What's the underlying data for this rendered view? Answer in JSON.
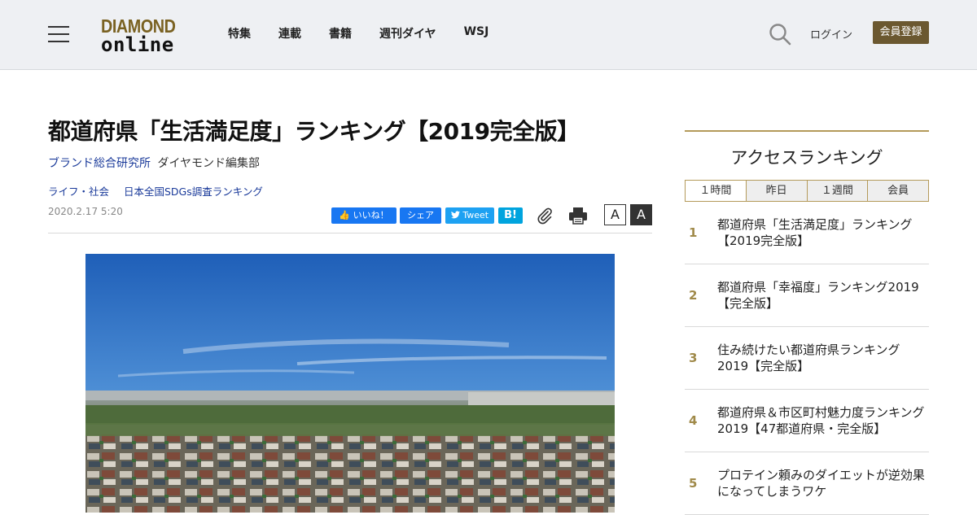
{
  "header": {
    "logo_line1": "DIAMOND",
    "logo_line2": "online",
    "nav": [
      "特集",
      "連載",
      "書籍",
      "週刊ダイヤ",
      "WSJ"
    ],
    "login": "ログイン",
    "register": "会員登録"
  },
  "article": {
    "title": "都道府県「生活満足度」ランキング【2019完全版】",
    "organization": "ブランド総合研究所",
    "department": "ダイヤモンド編集部",
    "tags": [
      "ライフ・社会",
      "日本全国SDGs調査ランキング"
    ],
    "date": "2020.2.17 5:20",
    "share": {
      "facebook_like": "いいね！",
      "facebook_share": "シェア",
      "tweet": "Tweet",
      "hatena": "B!"
    },
    "font_small": "A",
    "font_large": "A"
  },
  "sidebar": {
    "title": "アクセスランキング",
    "tabs": [
      "１時間",
      "昨日",
      "１週間",
      "会員"
    ],
    "items": [
      {
        "rank": "1",
        "text": "都道府県「生活満足度」ランキング【2019完全版】"
      },
      {
        "rank": "2",
        "text": "都道府県「幸福度」ランキング2019【完全版】"
      },
      {
        "rank": "3",
        "text": "住み続けたい都道府県ランキング2019【完全版】"
      },
      {
        "rank": "4",
        "text": "都道府県＆市区町村魅力度ランキング2019【47都道府県・完全版】"
      },
      {
        "rank": "5",
        "text": "プロテイン頼みのダイエットが逆効果になってしまうワケ"
      }
    ]
  },
  "colors": {
    "brand_gold": "#7a6222",
    "register_bg": "#6b5830",
    "link_blue": "#1a3a9a",
    "rank_accent": "#b49a5a"
  }
}
